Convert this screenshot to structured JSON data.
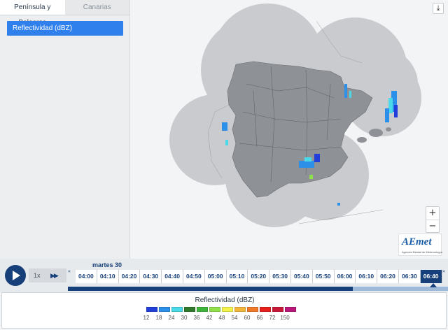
{
  "tabs": [
    {
      "label": "Península y Baleares",
      "active": true
    },
    {
      "label": "Canarias",
      "active": false
    }
  ],
  "layer": {
    "label": "Reflectividad (dBZ)",
    "selected": true
  },
  "download_icon": "download-icon",
  "zoom": {
    "in_label": "+",
    "out_label": "−"
  },
  "logo": {
    "name": "AEmet",
    "subtitle": "Agencia Estatal de Meteorología"
  },
  "timeline": {
    "play_icon": "play-icon",
    "speed": "1x",
    "fast_forward_icon": "fast-forward-icon",
    "day": "martes 30",
    "times": [
      "04:00",
      "04:10",
      "04:20",
      "04:30",
      "04:40",
      "04:50",
      "05:00",
      "05:10",
      "05:20",
      "05:30",
      "05:40",
      "05:50",
      "06:00",
      "06:10",
      "06:20",
      "06:30",
      "06:40"
    ],
    "active_index": 16,
    "progress": 0.75
  },
  "legend": {
    "title": "Reflectividad (dBZ)",
    "colors": [
      "#1f3fd8",
      "#2c8fe8",
      "#4ad9e8",
      "#2f7a2a",
      "#3fb43a",
      "#8fe04a",
      "#f2f24a",
      "#f2b63a",
      "#ef7a2a",
      "#e8201c",
      "#c8183a",
      "#b8167a"
    ],
    "values": [
      "12",
      "18",
      "24",
      "30",
      "36",
      "42",
      "48",
      "54",
      "60",
      "66",
      "72",
      "150"
    ]
  },
  "accent": "#17407a",
  "selection_color": "#2f80ed"
}
